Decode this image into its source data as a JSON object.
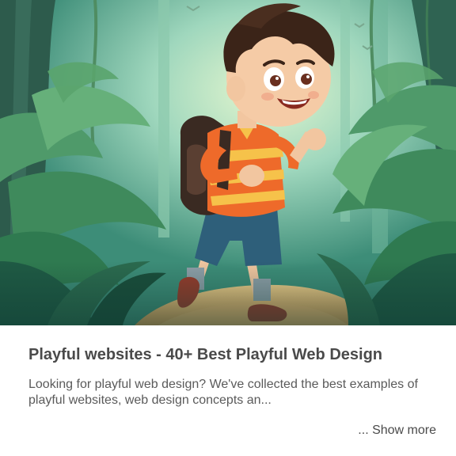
{
  "card": {
    "image_alt": "Cartoon boy with backpack walking through a jungle",
    "title": "Playful websites - 40+ Best Playful Web Design",
    "description": "Looking for playful web design? We've collected the best examples of playful websites, web design concepts an...",
    "show_more_label": "... Show more"
  },
  "colors": {
    "title": "#4a4a4a",
    "description": "#5a5a5a",
    "jungle_light": "#bfe6c8",
    "jungle_dark": "#1f5a4a",
    "shirt_orange": "#ee6a2a",
    "shorts_blue": "#2e5f7a"
  }
}
